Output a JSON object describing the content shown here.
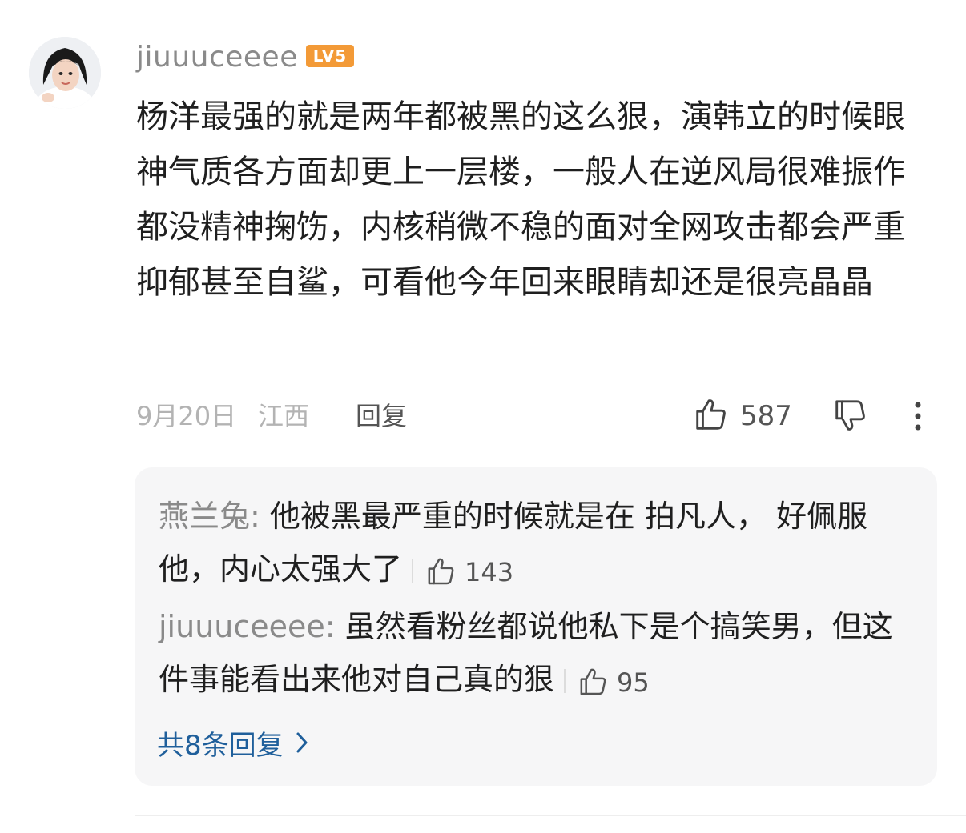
{
  "comment": {
    "username": "jiuuuceeee",
    "level_badge": "LV5",
    "text": "杨洋最强的就是两年都被黑的这么狠，演韩立的时候眼神气质各方面却更上一层楼，一般人在逆风局很难振作都没精神掬饬，内核稍微不稳的面对全网攻击都会严重抑郁甚至自鲨，可看他今年回来眼睛却还是很亮晶晶",
    "date": "9月20日",
    "location": "江西",
    "reply_label": "回复",
    "like_count": "587"
  },
  "replies": [
    {
      "author": "燕兰兔",
      "text": "他被黑最严重的时候就是在 拍凡人， 好佩服他，内心太强大了",
      "like_count": "143"
    },
    {
      "author": "jiuuuceeee",
      "text": "虽然看粉丝都说他私下是个搞笑男，但这件事能看出来他对自己真的狠",
      "like_count": "95"
    }
  ],
  "more_replies_label": "共8条回复",
  "colors": {
    "accent_link": "#1f5f9b",
    "badge": "#f39a37",
    "reply_bg": "#f6f6f7"
  },
  "icons": [
    "avatar",
    "thumbs-up-icon",
    "thumbs-down-icon",
    "more-vertical-icon",
    "chevron-right-icon"
  ]
}
